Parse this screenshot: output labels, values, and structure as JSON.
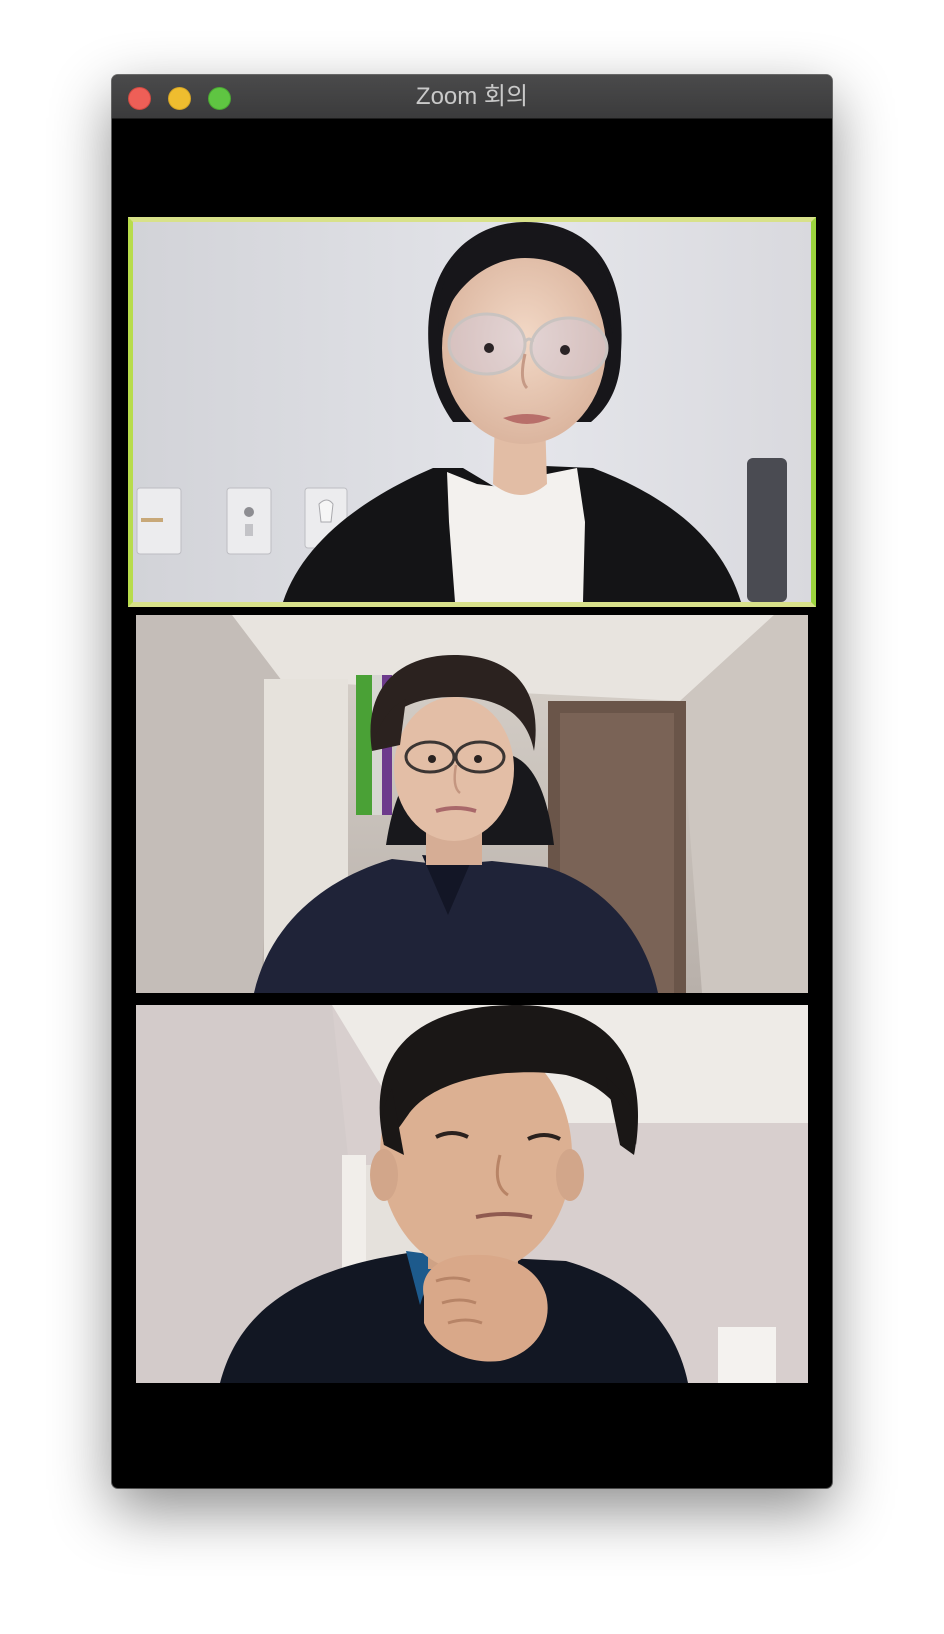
{
  "window": {
    "title": "Zoom 회의"
  },
  "controls": {
    "close_icon": "close-icon",
    "minimize_icon": "minimize-icon",
    "zoom_icon": "maximize-icon"
  },
  "meeting": {
    "layout": "gallery-view",
    "participant_count": 3,
    "active_speaker_index": 0,
    "active_speaker_border_color": "#d8e18a"
  },
  "colors": {
    "window_background": "#000000",
    "titlebar": "#3f3f40",
    "close": "#ee5f57",
    "minimize": "#efbd2f",
    "maximize": "#5fc542"
  }
}
